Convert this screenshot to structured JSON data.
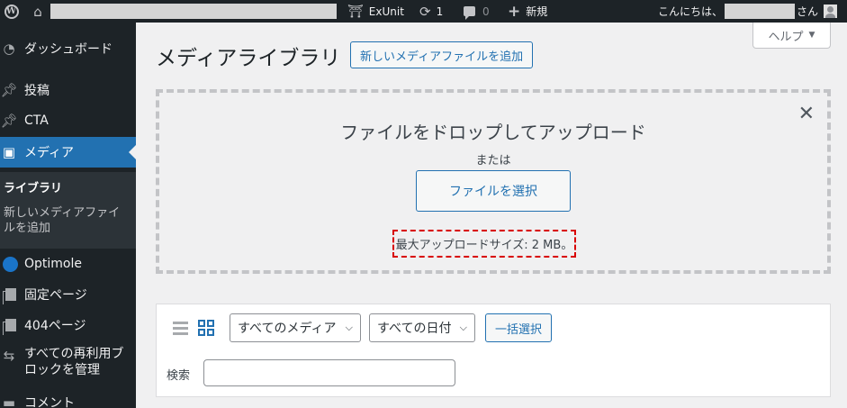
{
  "admin_bar": {
    "site_name_redacted": "",
    "exunit_label": "ExUnit",
    "updates_count": "1",
    "comments_count": "0",
    "new_label": "新規",
    "greeting_prefix": "こんにちは、",
    "greeting_suffix": "さん"
  },
  "sidebar": {
    "items": [
      {
        "label": "ダッシュボード",
        "icon": "dashboard-icon"
      },
      {
        "label": "投稿",
        "icon": "pin-icon"
      },
      {
        "label": "CTA",
        "icon": "pin-icon"
      },
      {
        "label": "メディア",
        "icon": "media-icon"
      },
      {
        "label": "Optimole",
        "icon": "optimole-icon"
      },
      {
        "label": "固定ページ",
        "icon": "page-icon"
      },
      {
        "label": "404ページ",
        "icon": "page-icon"
      },
      {
        "label": "すべての再利用ブロックを管理",
        "label_line1": "すべての再利用ブ",
        "label_line2": "ロックを管理",
        "icon": "reusable-blocks-icon"
      },
      {
        "label": "コメント",
        "icon": "comments-icon"
      }
    ],
    "submenu": {
      "library": "ライブラリ",
      "add_new_line1": "新しいメディアファイ",
      "add_new_line2": "ルを追加"
    }
  },
  "main": {
    "help_label": "ヘルプ",
    "title": "メディアライブラリ",
    "add_new_button": "新しいメディアファイルを追加",
    "uploader": {
      "drop_title": "ファイルをドロップしてアップロード",
      "or_text": "または",
      "select_button": "ファイルを選択",
      "max_size": "最大アップロードサイズ: 2 MB。"
    },
    "toolbar": {
      "media_filter": "すべてのメディア",
      "date_filter": "すべての日付",
      "bulk_select": "一括選択",
      "search_label": "検索",
      "search_value": ""
    }
  },
  "colors": {
    "admin_dark": "#1d2327",
    "accent": "#2271b1",
    "highlight_border": "#d80000"
  }
}
